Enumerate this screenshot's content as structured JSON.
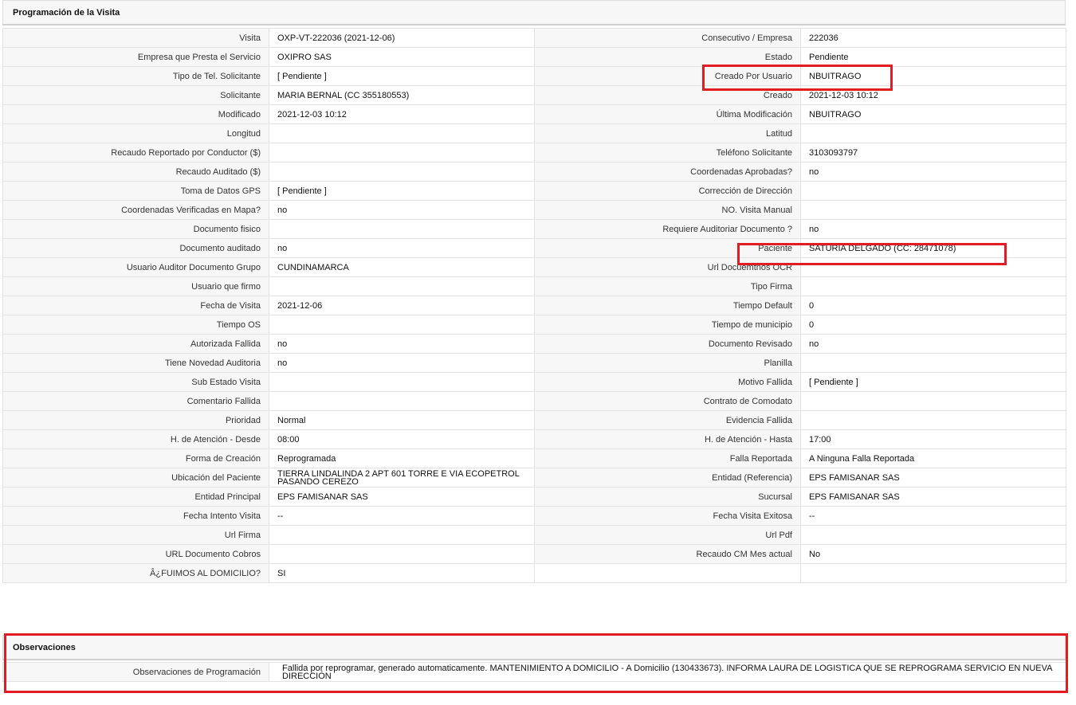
{
  "programacion": {
    "title": "Programación de la Visita",
    "rows": [
      {
        "l1": "Visita",
        "v1": "OXP-VT-222036 (2021-12-06)",
        "l2": "Consecutivo / Empresa",
        "v2": "222036"
      },
      {
        "l1": "Empresa que Presta el Servicio",
        "v1": "OXIPRO SAS",
        "l2": "Estado",
        "v2": "Pendiente"
      },
      {
        "l1": "Tipo de Tel. Solicitante",
        "v1": "[ Pendiente ]",
        "l2": "Creado Por Usuario",
        "v2": "NBUITRAGO"
      },
      {
        "l1": "Solicitante",
        "v1": "MARIA BERNAL (CC 355180553)",
        "l2": "Creado",
        "v2": "2021-12-03 10:12"
      },
      {
        "l1": "Modificado",
        "v1": "2021-12-03 10:12",
        "l2": "Última Modificación",
        "v2": " NBUITRAGO"
      },
      {
        "l1": "Longitud",
        "v1": "",
        "l2": "Latitud",
        "v2": ""
      },
      {
        "l1": "Recaudo Reportado por Conductor ($)",
        "v1": "",
        "l2": "Teléfono Solicitante",
        "v2": "3103093797"
      },
      {
        "l1": "Recaudo Auditado ($)",
        "v1": "",
        "l2": "Coordenadas Aprobadas?",
        "v2": " no"
      },
      {
        "l1": "Toma de Datos GPS",
        "v1": "[ Pendiente ]",
        "l2": "Corrección de Dirección",
        "v2": ""
      },
      {
        "l1": "Coordenadas Verificadas en Mapa?",
        "v1": " no",
        "l2": "NO. Visita Manual",
        "v2": ""
      },
      {
        "l1": "Documento fisico",
        "v1": "",
        "l2": "Requiere Auditoriar Documento ?",
        "v2": " no"
      },
      {
        "l1": "Documento auditado",
        "v1": " no",
        "l2": "Paciente",
        "v2": "SATURIA DELGADO (CC: 28471078)"
      },
      {
        "l1": "Usuario Auditor Documento Grupo",
        "v1": "CUNDINAMARCA",
        "l2": "Url Docuemtnos OCR",
        "v2": ""
      },
      {
        "l1": "Usuario que firmo",
        "v1": "",
        "l2": "Tipo Firma",
        "v2": ""
      },
      {
        "l1": "Fecha de Visita",
        "v1": " 2021-12-06",
        "l2": "Tiempo Default",
        "v2": " 0"
      },
      {
        "l1": "Tiempo OS",
        "v1": "",
        "l2": "Tiempo de municipio",
        "v2": " 0"
      },
      {
        "l1": "Autorizada Fallida",
        "v1": " no",
        "l2": "Documento Revisado",
        "v2": " no"
      },
      {
        "l1": "Tiene Novedad Auditoria",
        "v1": " no",
        "l2": "Planilla",
        "v2": ""
      },
      {
        "l1": "Sub Estado Visita",
        "v1": "",
        "l2": "Motivo Fallida",
        "v2": "[ Pendiente ]"
      },
      {
        "l1": "Comentario Fallida",
        "v1": "",
        "l2": "Contrato de Comodato",
        "v2": ""
      },
      {
        "l1": "Prioridad",
        "v1": "Normal",
        "l2": "Evidencia Fallida",
        "v2": ""
      },
      {
        "l1": "H. de Atención - Desde",
        "v1": "08:00",
        "l2": "H. de Atención - Hasta",
        "v2": "17:00"
      },
      {
        "l1": "Forma de Creación",
        "v1": "Reprogramada",
        "l2": "Falla Reportada",
        "v2": "A Ninguna Falla Reportada"
      },
      {
        "l1": "Ubicación del Paciente",
        "v1": "TIERRA LINDALINDA 2 APT 601 TORRE E VIA ECOPETROL PASANDO CEREZO",
        "l2": "Entidad (Referencia)",
        "v2": "EPS FAMISANAR SAS"
      },
      {
        "l1": "Entidad Principal",
        "v1": "EPS FAMISANAR SAS",
        "l2": "Sucursal",
        "v2": "EPS FAMISANAR SAS"
      },
      {
        "l1": "Fecha Intento Visita",
        "v1": "--",
        "l2": "Fecha Visita Exitosa",
        "v2": "--"
      },
      {
        "l1": "Url Firma",
        "v1": "",
        "l2": "Url Pdf",
        "v2": ""
      },
      {
        "l1": "URL Documento Cobros",
        "v1": "",
        "l2": "Recaudo CM Mes actual",
        "v2": " No"
      },
      {
        "l1": "Â¿FUIMOS AL DOMICILIO?",
        "v1": "SI",
        "l2": null,
        "v2": null
      }
    ]
  },
  "observaciones": {
    "title": "Observaciones",
    "label": "Observaciones de Programación",
    "value": "Fallida por reprogramar, generado automaticamente. MANTENIMIENTO A DOMICILIO - A Domicilio (130433673). INFORMA LAURA DE LOGISTICA QUE SE REPROGRAMA SERVICIO EN NUEVA DIRECCIÓN"
  },
  "highlight_color": "#e31b23"
}
